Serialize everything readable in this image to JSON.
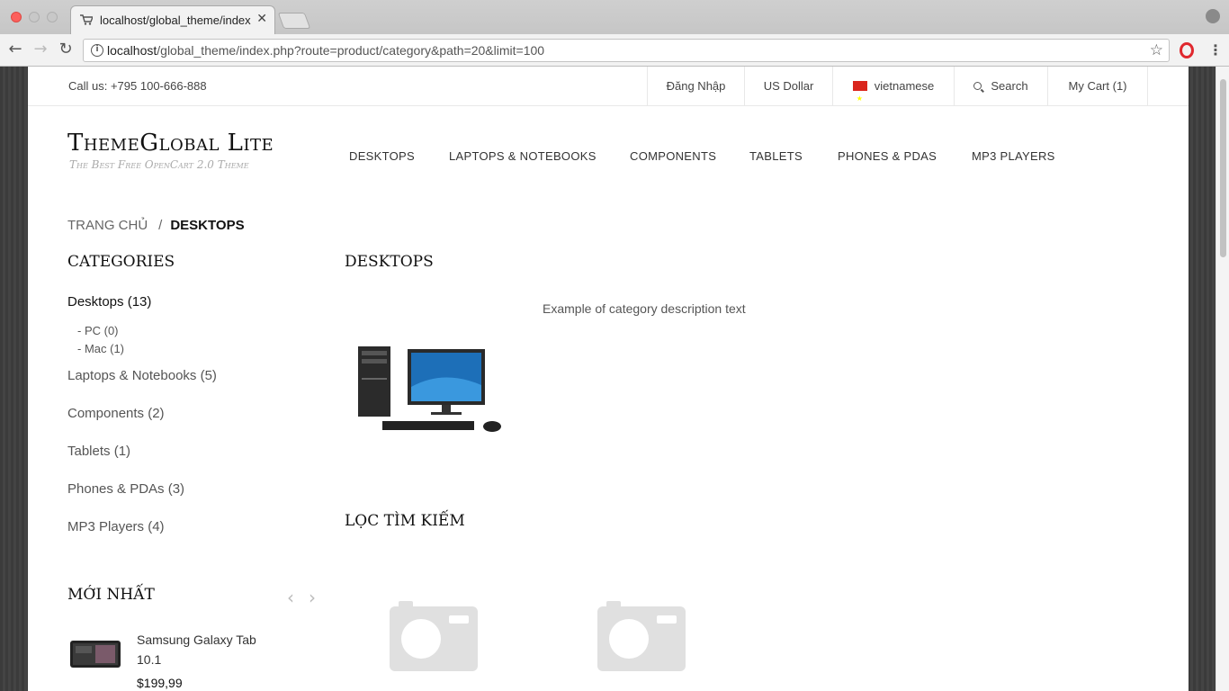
{
  "browser": {
    "tab_title": "localhost/global_theme/index.p",
    "url_host": "localhost",
    "url_rest": "/global_theme/index.php?route=product/category&path=20&limit=100"
  },
  "topbar": {
    "call_us": "Call us: +795 100-666-888",
    "login": "Đăng Nhập",
    "currency": "US Dollar",
    "language": "vietnamese",
    "search": "Search",
    "cart": "My Cart (1)"
  },
  "logo": {
    "title": "ThemeGlobal Lite",
    "subtitle": "The Best Free OpenCart 2.0 Theme"
  },
  "main_nav": [
    "DESKTOPS",
    "LAPTOPS & NOTEBOOKS",
    "COMPONENTS",
    "TABLETS",
    "PHONES & PDAS",
    "MP3 PLAYERS"
  ],
  "breadcrumb": {
    "home": "TRANG CHỦ",
    "separator": "/",
    "current": "DESKTOPS"
  },
  "sidebar": {
    "heading": "CATEGORIES",
    "categories": [
      {
        "label": "Desktops (13)"
      },
      {
        "label": "- PC (0)"
      },
      {
        "label": "- Mac (1)"
      },
      {
        "label": "Laptops & Notebooks (5)"
      },
      {
        "label": "Components (2)"
      },
      {
        "label": "Tablets (1)"
      },
      {
        "label": "Phones & PDAs (3)"
      },
      {
        "label": "MP3 Players (4)"
      }
    ],
    "latest_heading": "MỚI NHẤT",
    "latest_product": {
      "name": "Samsung Galaxy Tab 10.1",
      "price": "$199,99"
    }
  },
  "content": {
    "title": "DESKTOPS",
    "description": "Example of category description text",
    "filter_heading": "LỌC TÌM KIẾM"
  }
}
